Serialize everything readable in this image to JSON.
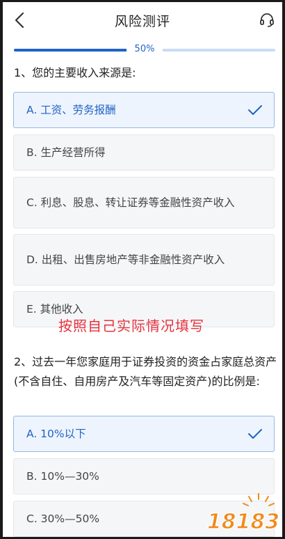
{
  "header": {
    "title": "风险测评"
  },
  "progress": {
    "label": "50%",
    "fraction": 0.5
  },
  "questions": [
    {
      "text": "1、您的主要收入来源是:",
      "options": [
        {
          "label": "A. 工资、劳务报酬",
          "selected": true
        },
        {
          "label": "B. 生产经营所得",
          "selected": false
        },
        {
          "label": "C. 利息、股息、转让证券等金融性资产收入",
          "selected": false
        },
        {
          "label": "D. 出租、出售房地产等非金融性资产收入",
          "selected": false
        },
        {
          "label": "E. 其他收入",
          "selected": false
        }
      ]
    },
    {
      "text": "2、过去一年您家庭用于证券投资的资金占家庭总资产(不含自住、自用房产及汽车等固定资产)的比例是:",
      "options": [
        {
          "label": "A. 10%以下",
          "selected": true
        },
        {
          "label": "B. 10%—30%",
          "selected": false
        },
        {
          "label": "C. 30%—50%",
          "selected": false
        }
      ]
    }
  ],
  "annotation": "按照自己实际情况填写",
  "watermark": {
    "text": "18183"
  },
  "colors": {
    "accent": "#1f63c6",
    "annotation": "#e8323c",
    "watermark": "#f08a1c"
  },
  "icons": {
    "back": "chevron-left-icon",
    "service": "headset-icon",
    "check": "check-icon"
  }
}
